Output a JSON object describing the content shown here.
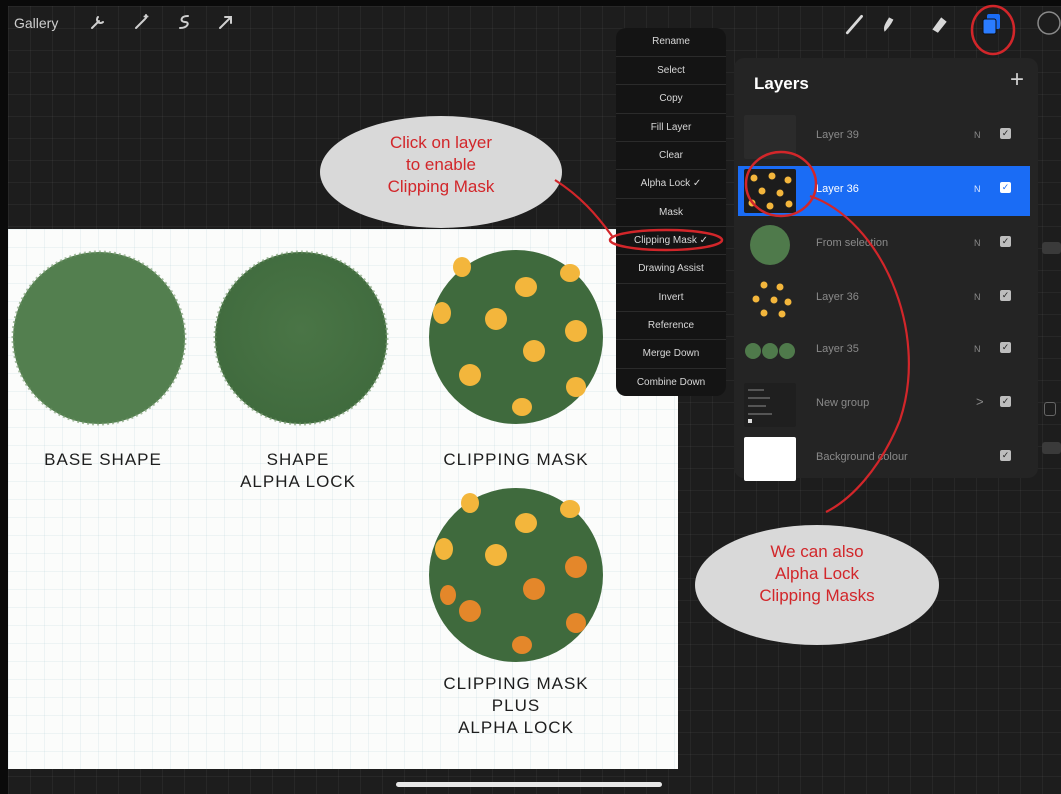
{
  "toolbar": {
    "gallery_label": "Gallery",
    "left_tools": [
      "wrench-icon",
      "magic-wand-icon",
      "selection-icon",
      "transform-arrow-icon"
    ],
    "right_tools": [
      "brush-icon",
      "smudge-icon",
      "eraser-icon",
      "layers-icon",
      "color-icon"
    ]
  },
  "menu": {
    "items": [
      "Rename",
      "Select",
      "Copy",
      "Fill Layer",
      "Clear",
      "Alpha Lock ✓",
      "Mask",
      "Clipping Mask ✓",
      "Drawing Assist",
      "Invert",
      "Reference",
      "Merge Down",
      "Combine Down"
    ]
  },
  "layers": {
    "title": "Layers",
    "add_label": "+",
    "rows": [
      {
        "name": "Layer 39",
        "blend": "N",
        "thumb": "empty"
      },
      {
        "name": "Layer 36",
        "blend": "N",
        "thumb": "dots",
        "selected": true
      },
      {
        "name": "From selection",
        "blend": "N",
        "thumb": "circle"
      },
      {
        "name": "Layer 36",
        "blend": "N",
        "thumb": "dots-light"
      },
      {
        "name": "Layer 35",
        "blend": "N",
        "thumb": "three-circles"
      },
      {
        "name": "New group",
        "blend": ">",
        "thumb": "group"
      },
      {
        "name": "Background colour",
        "blend": "",
        "thumb": "white"
      }
    ]
  },
  "canvas": {
    "labels": {
      "base_shape": "BASE SHAPE",
      "shape_alpha_lock": "SHAPE\nALPHA LOCK",
      "clipping_mask": "CLIPPING MASK",
      "clipping_mask_plus": "CLIPPING MASK\nPLUS\nALPHA LOCK"
    }
  },
  "callouts": {
    "top": "Click on layer\nto enable\nClipping Mask",
    "bottom": "We can also\nAlpha Lock\nClipping Masks"
  },
  "colors": {
    "accent_blue": "#1a6cf5",
    "annotation_red": "#d2262a",
    "shape_green": "#4f7a4b",
    "dot_yellow": "#f3b63c",
    "dot_orange": "#e4872a"
  }
}
